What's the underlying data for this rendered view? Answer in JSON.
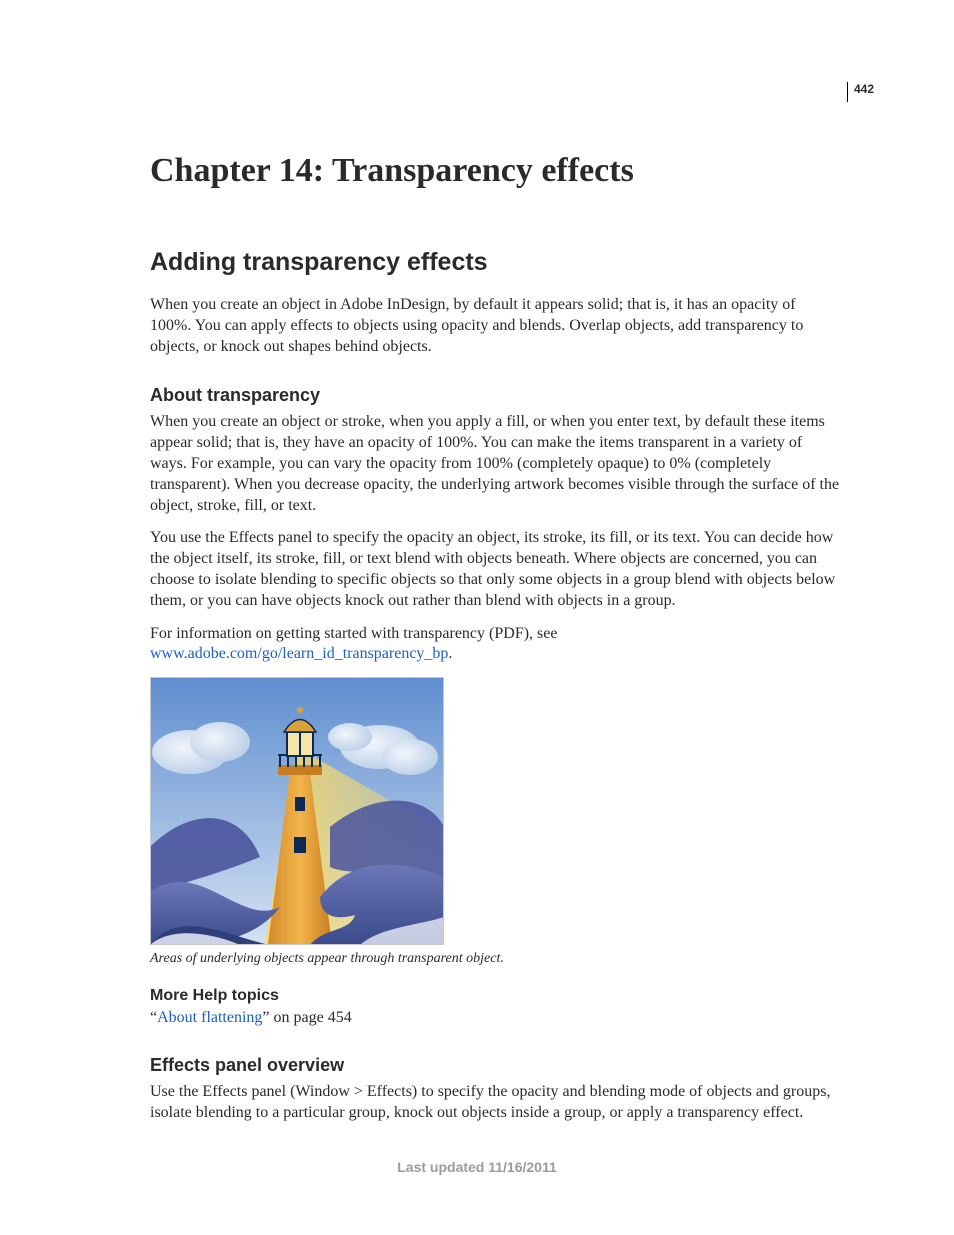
{
  "page_number": "442",
  "chapter_title": "Chapter 14: Transparency effects",
  "section_title": "Adding transparency effects",
  "intro_paragraph": "When you create an object in Adobe InDesign, by default it appears solid; that is, it has an opacity of 100%. You can apply effects to objects using opacity and blends. Overlap objects, add transparency to objects, or knock out shapes behind objects.",
  "about": {
    "heading": "About transparency",
    "p1": "When you create an object or stroke, when you apply a fill, or when you enter text, by default these items appear solid; that is, they have an opacity of 100%. You can make the items transparent in a variety of ways. For example, you can vary the opacity from 100% (completely opaque) to 0% (completely transparent). When you decrease opacity, the underlying artwork becomes visible through the surface of the object, stroke, fill, or text.",
    "p2": "You use the Effects panel to specify the opacity an object, its stroke, its fill, or its text. You can decide how the object itself, its stroke, fill, or text blend with objects beneath. Where objects are concerned, you can choose to isolate blending to specific objects so that only some objects in a group blend with objects below them, or you can have objects knock out rather than blend with objects in a group.",
    "p3_prefix": "For information on getting started with transparency (PDF), see ",
    "p3_link": "www.adobe.com/go/learn_id_transparency_bp",
    "p3_suffix": "."
  },
  "figure_caption": "Areas of underlying objects appear through transparent object.",
  "more_help": {
    "heading": "More Help topics",
    "item_prefix": "“",
    "item_link": "About flattening",
    "item_suffix": "” on page 454"
  },
  "effects_panel": {
    "heading": "Effects panel overview",
    "p1": "Use the Effects panel (Window > Effects) to specify the opacity and blending mode of objects and groups, isolate blending to a particular group, knock out objects inside a group, or apply a transparency effect."
  },
  "footer": "Last updated 11/16/2011"
}
